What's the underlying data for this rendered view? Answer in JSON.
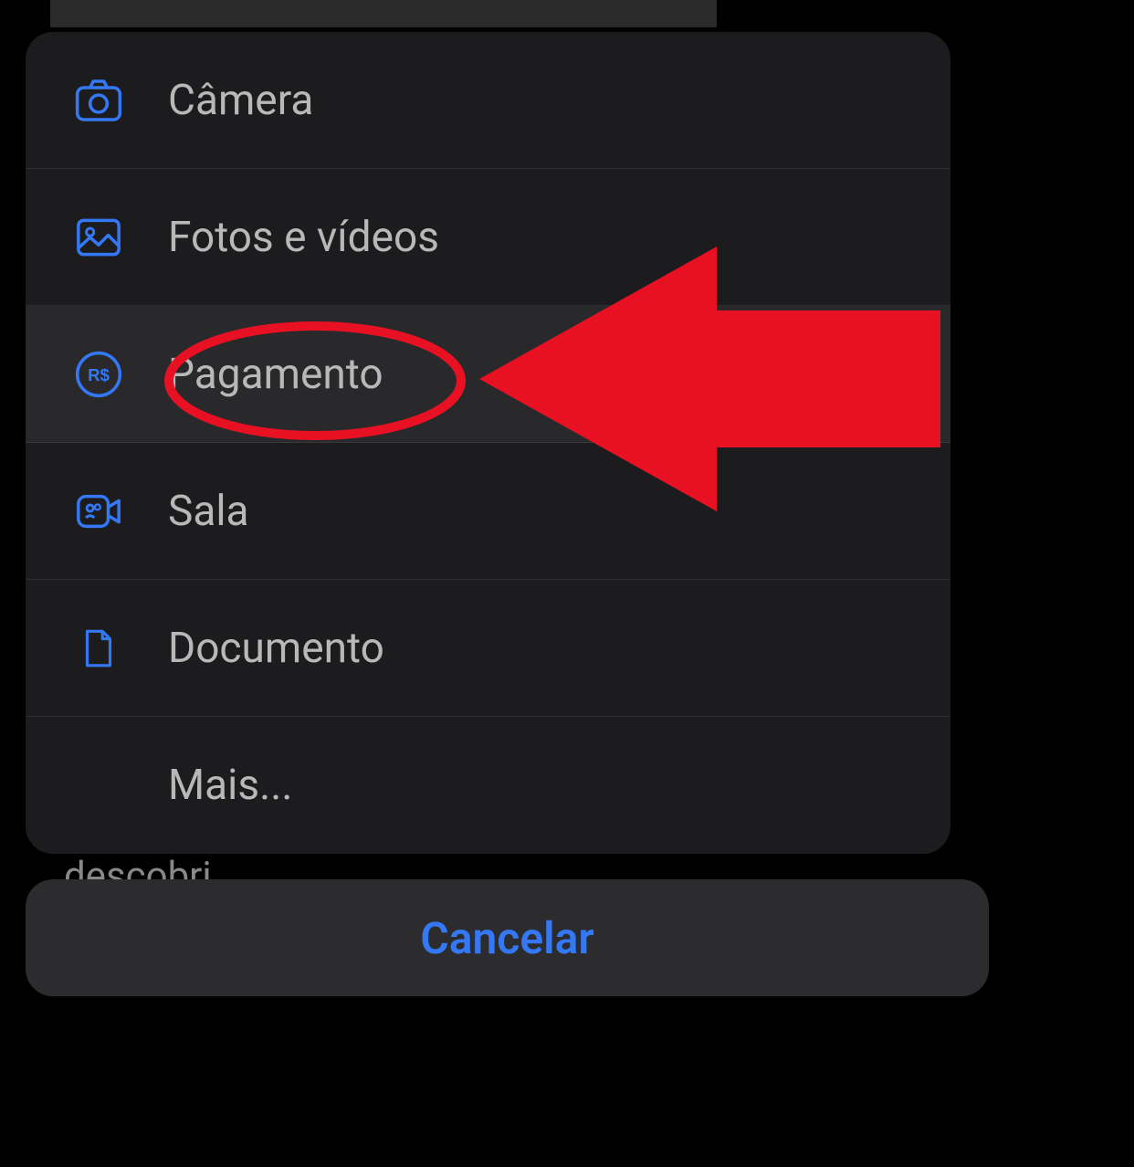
{
  "menu": {
    "items": [
      {
        "id": "camera",
        "label": "Câmera",
        "icon": "camera-icon"
      },
      {
        "id": "photos",
        "label": "Fotos e vídeos",
        "icon": "photo-icon"
      },
      {
        "id": "payment",
        "label": "Pagamento",
        "icon": "payment-icon"
      },
      {
        "id": "room",
        "label": "Sala",
        "icon": "room-icon"
      },
      {
        "id": "document",
        "label": "Documento",
        "icon": "document-icon"
      },
      {
        "id": "more",
        "label": "Mais...",
        "icon": null
      }
    ]
  },
  "cancel": {
    "label": "Cancelar"
  },
  "background_text": "descobri",
  "colors": {
    "accent": "#3478f6",
    "annotation": "#e81123"
  },
  "annotation": {
    "circled_item": "payment",
    "arrow_target": "payment"
  }
}
